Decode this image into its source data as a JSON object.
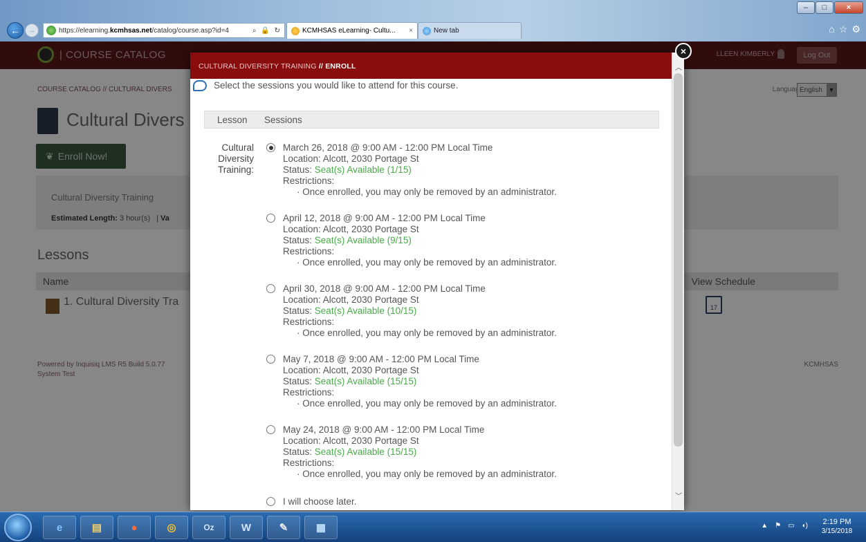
{
  "browser": {
    "url_prefix": "https://elearning.",
    "url_domain": "kcmhsas.net",
    "url_path": "/catalog/course.asp?id=4",
    "tabs": [
      {
        "label": "KCMHSAS eLearning- Cultu...",
        "close": "×"
      },
      {
        "label": "New tab"
      }
    ]
  },
  "site": {
    "catalog_title": "| COURSE CATALOG",
    "username": "LLEEN KIMBERLY",
    "logout": "Log Out",
    "breadcrumb": "COURSE CATALOG // CULTURAL DIVERS",
    "language_label": "Language:",
    "language_value": "English",
    "course_title": "Cultural Divers",
    "enroll_button": "Enroll Now!",
    "info_name": "Cultural Diversity Training",
    "info_length_label": "Estimated Length:",
    "info_length_value": "3 hour(s)",
    "info_extra": "Va",
    "lessons_heading": "Lessons",
    "col_name": "Name",
    "col_schedule": "View Schedule",
    "lesson_row": "1. Cultural Diversity Tra",
    "calendar_day": "17",
    "footer_line1": "Powered by Inquisiq LMS R5 Build 5.0.77",
    "footer_line2": "System Test",
    "footer_right": "KCMHSAS"
  },
  "modal": {
    "title_prefix": "CULTURAL DIVERSITY TRAINING",
    "title_suffix": "// ENROLL",
    "close": "×",
    "instructions": "Select the sessions you would like to attend for this course.",
    "th_lesson": "Lesson",
    "th_sessions": "Sessions",
    "lesson_label": "Cultural Diversity Training:",
    "sessions": [
      {
        "datetime": "March 26, 2018 @ 9:00 AM - 12:00 PM Local Time",
        "location": "Location: Alcott, 2030 Portage St",
        "status_label": "Status:",
        "status_value": "Seat(s) Available (1/15)",
        "restrictions_label": "Restrictions:",
        "restriction": "· Once enrolled, you may only be removed by an administrator.",
        "selected": true
      },
      {
        "datetime": "April 12, 2018 @ 9:00 AM - 12:00 PM Local Time",
        "location": "Location: Alcott, 2030 Portage St",
        "status_label": "Status:",
        "status_value": "Seat(s) Available (9/15)",
        "restrictions_label": "Restrictions:",
        "restriction": "· Once enrolled, you may only be removed by an administrator.",
        "selected": false
      },
      {
        "datetime": "April 30, 2018 @ 9:00 AM - 12:00 PM Local Time",
        "location": "Location: Alcott, 2030 Portage St",
        "status_label": "Status:",
        "status_value": "Seat(s) Available (10/15)",
        "restrictions_label": "Restrictions:",
        "restriction": "· Once enrolled, you may only be removed by an administrator.",
        "selected": false
      },
      {
        "datetime": "May 7, 2018 @ 9:00 AM - 12:00 PM Local Time",
        "location": "Location: Alcott, 2030 Portage St",
        "status_label": "Status:",
        "status_value": "Seat(s) Available (15/15)",
        "restrictions_label": "Restrictions:",
        "restriction": "· Once enrolled, you may only be removed by an administrator.",
        "selected": false
      },
      {
        "datetime": "May 24, 2018 @ 9:00 AM - 12:00 PM Local Time",
        "location": "Location: Alcott, 2030 Portage St",
        "status_label": "Status:",
        "status_value": "Seat(s) Available (15/15)",
        "restrictions_label": "Restrictions:",
        "restriction": "· Once enrolled, you may only be removed by an administrator.",
        "selected": false
      }
    ],
    "choose_later": "I will choose later."
  },
  "taskbar": {
    "apps": [
      "e",
      "▤",
      "●",
      "◎",
      "Oz",
      "W",
      "✎",
      "▦"
    ],
    "time": "2:19 PM",
    "date": "3/15/2018"
  },
  "colors": {
    "modal_header": "#8a0d0d",
    "site_header": "#5b1818",
    "status_green": "#4aa94a"
  }
}
